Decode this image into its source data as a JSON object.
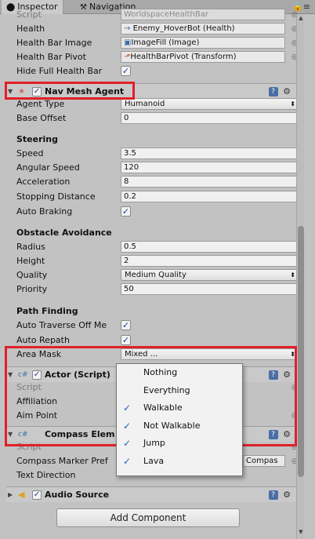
{
  "tabs": [
    {
      "label": "Inspector",
      "icon": "info-icon"
    },
    {
      "label": "Navigation",
      "icon": "navigation-icon"
    }
  ],
  "top_rows": [
    {
      "label": "Script",
      "value": "WorldspaceHealthBar"
    },
    {
      "label": "Health",
      "value": "Enemy_HoverBot (Health)",
      "icon": "script-icon"
    },
    {
      "label": "Health Bar Image",
      "value": "ImageFill (Image)",
      "icon": "image-icon"
    },
    {
      "label": "Health Bar Pivot",
      "value": "HealthBarPivot (Transform)",
      "icon": "transform-icon"
    },
    {
      "label": "Hide Full Health Bar",
      "checked": true
    }
  ],
  "nav_mesh_agent": {
    "title": "Nav Mesh Agent",
    "agent_type_label": "Agent Type",
    "agent_type_value": "Humanoid",
    "base_offset_label": "Base Offset",
    "base_offset_value": "0",
    "steering_title": "Steering",
    "speed_label": "Speed",
    "speed_value": "3.5",
    "angular_speed_label": "Angular Speed",
    "angular_speed_value": "120",
    "acceleration_label": "Acceleration",
    "acceleration_value": "8",
    "stopping_distance_label": "Stopping Distance",
    "stopping_distance_value": "0.2",
    "auto_braking_label": "Auto Braking",
    "auto_braking_checked": true,
    "obstacle_title": "Obstacle Avoidance",
    "radius_label": "Radius",
    "radius_value": "0.5",
    "height_label": "Height",
    "height_value": "2",
    "quality_label": "Quality",
    "quality_value": "Medium Quality",
    "priority_label": "Priority",
    "priority_value": "50",
    "pathfinding_title": "Path Finding",
    "auto_traverse_label": "Auto Traverse Off Me",
    "auto_traverse_checked": true,
    "auto_repath_label": "Auto Repath",
    "auto_repath_checked": true,
    "area_mask_label": "Area Mask",
    "area_mask_value": "Mixed ..."
  },
  "actor_script": {
    "title": "Actor (Script)",
    "script_label": "Script",
    "affiliation_label": "Affiliation",
    "aim_point_label": "Aim Point"
  },
  "compass_element": {
    "title": "Compass Elem",
    "script_label": "Script",
    "marker_label": "Compass Marker Pref",
    "marker_value": "Compas",
    "text_direction_label": "Text Direction"
  },
  "audio_source": {
    "title": "Audio Source"
  },
  "add_component_label": "Add Component",
  "area_mask_options": [
    {
      "label": "Nothing",
      "checked": false
    },
    {
      "label": "Everything",
      "checked": false
    },
    {
      "label": "Walkable",
      "checked": true
    },
    {
      "label": "Not Walkable",
      "checked": true
    },
    {
      "label": "Jump",
      "checked": true
    },
    {
      "label": "Lava",
      "checked": true
    }
  ],
  "check_glyph": "✓",
  "highlight_color": "#e0202a",
  "check_color": "#1b62c4"
}
